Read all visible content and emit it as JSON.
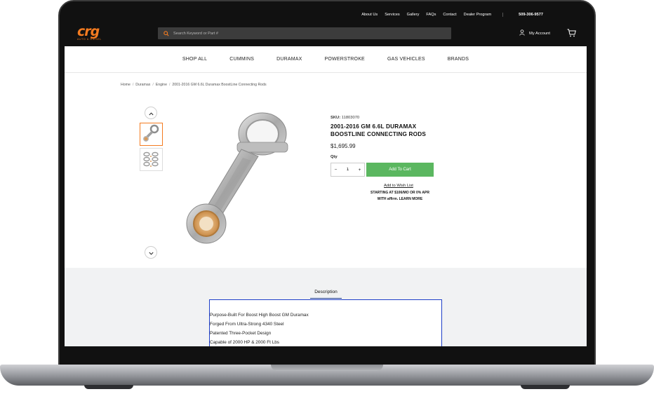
{
  "utility_bar": {
    "links": [
      "About Us",
      "Services",
      "Gallery",
      "FAQs",
      "Contact",
      "Dealer Program"
    ],
    "phone": "509-306-9577"
  },
  "header": {
    "logo_text": "crg",
    "logo_sub": "AUTO & DIESEL",
    "search_placeholder": "Search Keyword or Part #",
    "account_label": "My Account"
  },
  "nav": {
    "items": [
      "SHOP ALL",
      "CUMMINS",
      "DURAMAX",
      "POWERSTROKE",
      "GAS VEHICLES",
      "BRANDS"
    ]
  },
  "breadcrumb": [
    "Home",
    "Duramax",
    "Engine",
    "2001-2016 GM 6.6L Duramax BoostLine Connecting Rods"
  ],
  "product": {
    "sku_label": "SKU:",
    "sku": "11803070",
    "name": "2001-2016 GM 6.6L DURAMAX BOOSTLINE CONNECTING RODS",
    "price": "$1,695.99",
    "qty_label": "Qty",
    "qty_value": "1",
    "qty_minus": "−",
    "qty_plus": "+",
    "add_to_cart": "Add To Cart",
    "wish_list": "Add to Wish List",
    "affirm_text": "STARTING AT $106/MO OR 0% APR WITH affirm. LEARN MORE"
  },
  "description": {
    "tab_label": "Description",
    "bullets": [
      "Purpose-Built For Boost High Boost GM Duramax",
      "Forged From Ultra-Strong 4340 Steel",
      "Patented Three-Pocket Design",
      "Capable of 2000 HP & 2000 Ft Lbs"
    ]
  },
  "colors": {
    "brand_orange": "#f47b20",
    "header_black": "#111111",
    "cart_green": "#5bb760",
    "focus_blue": "#1f3fc9"
  }
}
